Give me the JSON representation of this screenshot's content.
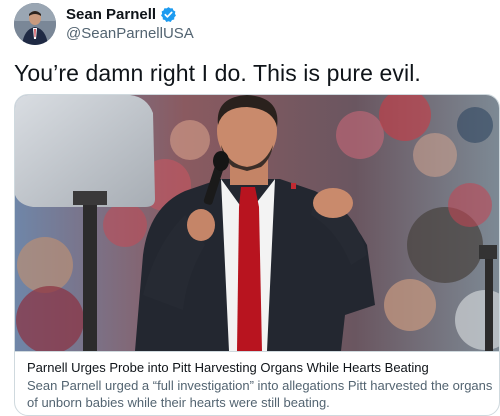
{
  "author": {
    "display_name": "Sean Parnell",
    "handle": "@SeanParnellUSA",
    "verified": true,
    "avatar_icon": "profile-photo"
  },
  "tweet": {
    "text": "You’re damn right I do. This is pure evil."
  },
  "card": {
    "image_icon": "news-photo",
    "title": "Parnell Urges Probe into Pitt Harvesting Organs While Hearts Beating",
    "description": "Sean Parnell urged a “full investigation” into allegations Pitt harvested the organs of unborn babies while their hearts were still beating."
  },
  "colors": {
    "text_primary": "#0f1419",
    "text_secondary": "#536471",
    "verified_blue": "#1d9bf0",
    "border": "#cfd9de"
  }
}
